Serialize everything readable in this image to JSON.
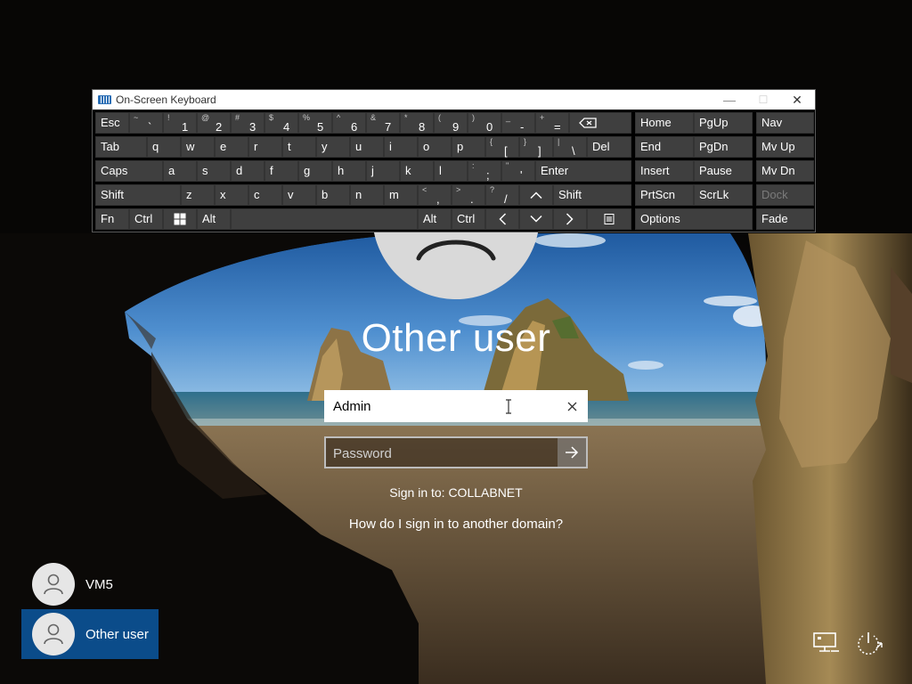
{
  "window": {
    "title": "On-Screen Keyboard",
    "minimize": "—",
    "maximize": "☐",
    "close": "✕"
  },
  "keyboard": {
    "row1": [
      {
        "l": "Esc"
      },
      {
        "s": "~",
        "m": "`"
      },
      {
        "s": "!",
        "m": "1"
      },
      {
        "s": "@",
        "m": "2"
      },
      {
        "s": "#",
        "m": "3"
      },
      {
        "s": "$",
        "m": "4"
      },
      {
        "s": "%",
        "m": "5"
      },
      {
        "s": "^",
        "m": "6"
      },
      {
        "s": "&",
        "m": "7"
      },
      {
        "s": "*",
        "m": "8"
      },
      {
        "s": "(",
        "m": "9"
      },
      {
        "s": ")",
        "m": "0"
      },
      {
        "s": "_",
        "m": "-"
      },
      {
        "s": "+",
        "m": "="
      }
    ],
    "row2": [
      "Tab",
      "q",
      "w",
      "e",
      "r",
      "t",
      "y",
      "u",
      "i",
      "o",
      "p"
    ],
    "row2_brackets": [
      {
        "s": "{",
        "m": "["
      },
      {
        "s": "}",
        "m": "]"
      },
      {
        "s": "|",
        "m": "\\"
      }
    ],
    "row2_del": "Del",
    "row3": [
      "Caps",
      "a",
      "s",
      "d",
      "f",
      "g",
      "h",
      "j",
      "k",
      "l"
    ],
    "row3_punct": [
      {
        "s": ":",
        "m": ";"
      },
      {
        "s": "\"",
        "m": "'"
      }
    ],
    "row3_enter": "Enter",
    "row4_shift_left": "Shift",
    "row4": [
      "z",
      "x",
      "c",
      "v",
      "b",
      "n",
      "m"
    ],
    "row4_punct": [
      {
        "s": "<",
        "m": ","
      },
      {
        "s": ">",
        "m": "."
      },
      {
        "s": "?",
        "m": "/"
      }
    ],
    "row4_shift_right": "Shift",
    "row5": {
      "fn": "Fn",
      "ctrl_left": "Ctrl",
      "alt_left": "Alt",
      "alt_right": "Alt",
      "ctrl_right": "Ctrl"
    },
    "nav": {
      "home": "Home",
      "pgup": "PgUp",
      "nav": "Nav",
      "end": "End",
      "pgdn": "PgDn",
      "mvup": "Mv Up",
      "insert": "Insert",
      "pause": "Pause",
      "mvdn": "Mv Dn",
      "prtscn": "PrtScn",
      "scrlk": "ScrLk",
      "dock": "Dock",
      "options": "Options",
      "fade": "Fade"
    }
  },
  "login": {
    "user_name": "Other user",
    "username_value": "Admin",
    "password_placeholder": "Password",
    "sign_in_to": "Sign in to: COLLABNET",
    "domain_link": "How do I sign in to another domain?"
  },
  "users": [
    {
      "name": "VM5",
      "selected": false
    },
    {
      "name": "Other user",
      "selected": true
    }
  ],
  "icons": {
    "network": "network-icon",
    "ease_of_access": "ease-of-access-icon",
    "power": "power-icon"
  }
}
